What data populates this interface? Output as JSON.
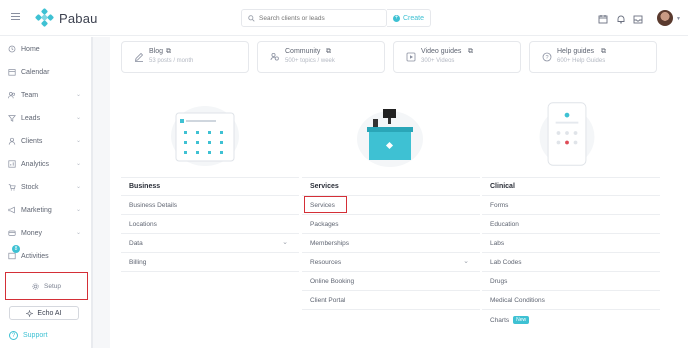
{
  "header": {
    "brand": "Pabau",
    "search_placeholder": "Search clients or leads",
    "create_label": "Create"
  },
  "sidebar": {
    "items": [
      {
        "label": "Home",
        "icon": "home-icon"
      },
      {
        "label": "Calendar",
        "icon": "calendar-icon"
      },
      {
        "label": "Team",
        "icon": "team-icon"
      },
      {
        "label": "Leads",
        "icon": "leads-icon"
      },
      {
        "label": "Clients",
        "icon": "clients-icon"
      },
      {
        "label": "Analytics",
        "icon": "analytics-icon"
      },
      {
        "label": "Stock",
        "icon": "stock-icon"
      },
      {
        "label": "Marketing",
        "icon": "marketing-icon"
      },
      {
        "label": "Money",
        "icon": "money-icon"
      },
      {
        "label": "Activities",
        "icon": "activities-icon"
      }
    ],
    "activities_badge": "8",
    "setup_label": "Setup",
    "echo_label": "Echo AI",
    "support_label": "Support"
  },
  "cards": [
    {
      "title": "Blog",
      "subtitle": "53 posts / month"
    },
    {
      "title": "Community",
      "subtitle": "500+ topics / week"
    },
    {
      "title": "Video guides",
      "subtitle": "300+ Videos"
    },
    {
      "title": "Help guides",
      "subtitle": "600+ Help Guides"
    }
  ],
  "columns": {
    "business": {
      "title": "Business",
      "items": [
        "Business Details",
        "Locations",
        "Data",
        "Billing"
      ]
    },
    "services": {
      "title": "Services",
      "items": [
        "Services",
        "Packages",
        "Memberships",
        "Resources",
        "Online Booking",
        "Client Portal"
      ]
    },
    "clinical": {
      "title": "Clinical",
      "items": [
        "Forms",
        "Education",
        "Labs",
        "Lab Codes",
        "Drugs",
        "Medical Conditions",
        "Charts"
      ],
      "new_badge": "New"
    }
  },
  "colors": {
    "accent": "#3ec1d3",
    "highlight": "#d42f37"
  }
}
